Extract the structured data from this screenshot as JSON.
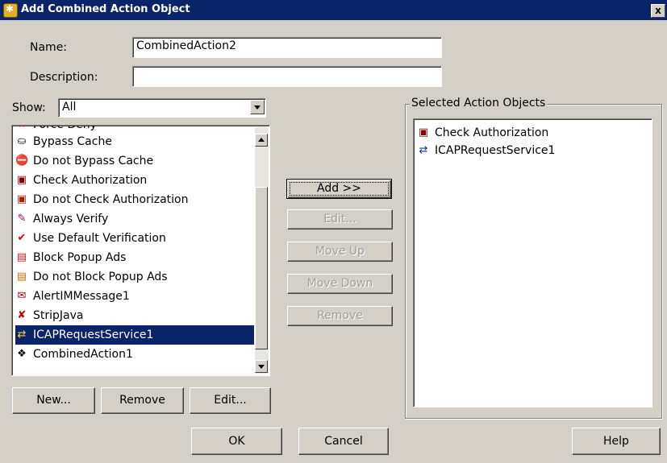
{
  "window": {
    "title": "Add Combined Action Object",
    "close_label": "x"
  },
  "form": {
    "name_label": "Name:",
    "name_value": "CombinedAction2",
    "description_label": "Description:",
    "description_value": "",
    "show_label": "Show:",
    "show_value": "All"
  },
  "available_list": {
    "partial_top_item": "Force Deny",
    "items": [
      {
        "label": "Bypass Cache",
        "icon": "bypass-cache-icon"
      },
      {
        "label": "Do not Bypass Cache",
        "icon": "do-not-bypass-cache-icon"
      },
      {
        "label": "Check Authorization",
        "icon": "check-authorization-icon"
      },
      {
        "label": "Do not Check Authorization",
        "icon": "do-not-check-authorization-icon"
      },
      {
        "label": "Always Verify",
        "icon": "always-verify-icon"
      },
      {
        "label": "Use Default Verification",
        "icon": "default-verification-icon"
      },
      {
        "label": "Block Popup Ads",
        "icon": "block-popup-icon"
      },
      {
        "label": "Do not Block Popup Ads",
        "icon": "do-not-block-popup-icon"
      },
      {
        "label": "AlertIMMessage1",
        "icon": "alert-im-icon"
      },
      {
        "label": "StripJava",
        "icon": "strip-java-icon"
      },
      {
        "label": "ICAPRequestService1",
        "icon": "icap-request-icon",
        "selected": true
      },
      {
        "label": "CombinedAction1",
        "icon": "combined-action-icon"
      }
    ]
  },
  "middle_buttons": {
    "add": "Add >>",
    "edit": "Edit...",
    "move_up": "Move Up",
    "move_down": "Move Down",
    "remove": "Remove"
  },
  "bottom_left_buttons": {
    "new": "New...",
    "remove": "Remove",
    "edit": "Edit..."
  },
  "selected_group": {
    "title": "Selected Action Objects",
    "items": [
      {
        "label": "Check Authorization",
        "icon": "check-authorization-icon"
      },
      {
        "label": "ICAPRequestService1",
        "icon": "icap-request-icon"
      }
    ]
  },
  "dialog_buttons": {
    "ok": "OK",
    "cancel": "Cancel",
    "help": "Help"
  }
}
